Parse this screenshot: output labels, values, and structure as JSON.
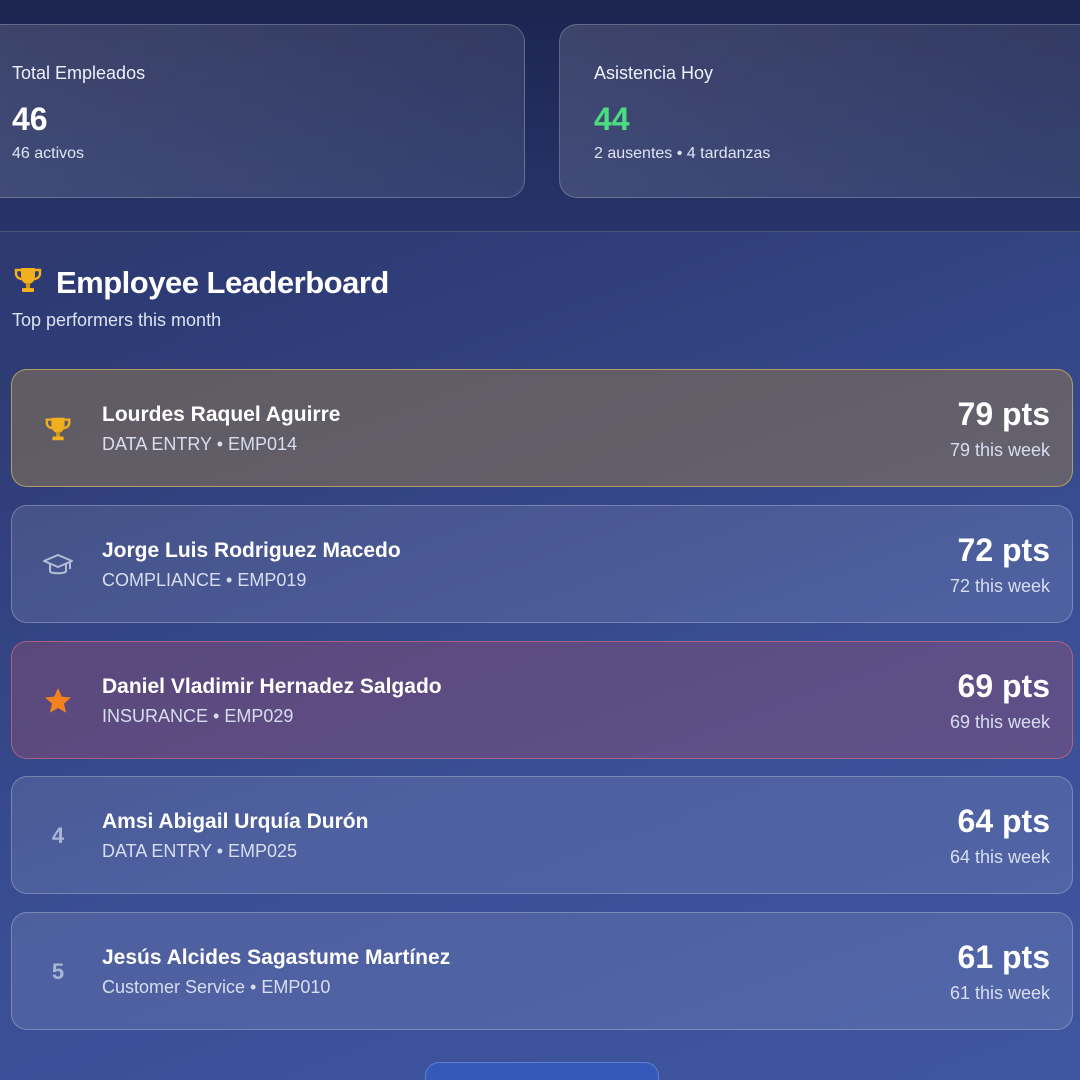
{
  "stats": [
    {
      "label": "Total Empleados",
      "value": "46",
      "sub": "46 activos"
    },
    {
      "label": "Asistencia Hoy",
      "value": "44",
      "sub": "2 ausentes • 4 tardanzas",
      "value_color": "#4ade80"
    }
  ],
  "leaderboard": {
    "title": "Employee Leaderboard",
    "subtitle": "Top performers this month",
    "icon": "trophy-icon",
    "rows": [
      {
        "rank_icon": "trophy-icon",
        "name": "Lourdes Raquel Aguirre",
        "meta": "DATA ENTRY • EMP014",
        "points": "79 pts",
        "week": "79 this week"
      },
      {
        "rank_icon": "graduation-cap-icon",
        "name": "Jorge Luis Rodriguez Macedo",
        "meta": "COMPLIANCE • EMP019",
        "points": "72 pts",
        "week": "72 this week"
      },
      {
        "rank_icon": "star-icon",
        "name": "Daniel Vladimir Hernadez Salgado",
        "meta": "INSURANCE • EMP029",
        "points": "69 pts",
        "week": "69 this week"
      },
      {
        "rank": "4",
        "name": "Amsi Abigail Urquía Durón",
        "meta": "DATA ENTRY • EMP025",
        "points": "64 pts",
        "week": "64 this week"
      },
      {
        "rank": "5",
        "name": "Jesús Alcides Sagastume Martínez",
        "meta": "Customer Service • EMP010",
        "points": "61 pts",
        "week": "61 this week"
      }
    ]
  },
  "colors": {
    "accent_green": "#4ade80",
    "gold": "#f2b01e",
    "bronze": "#f58220"
  }
}
